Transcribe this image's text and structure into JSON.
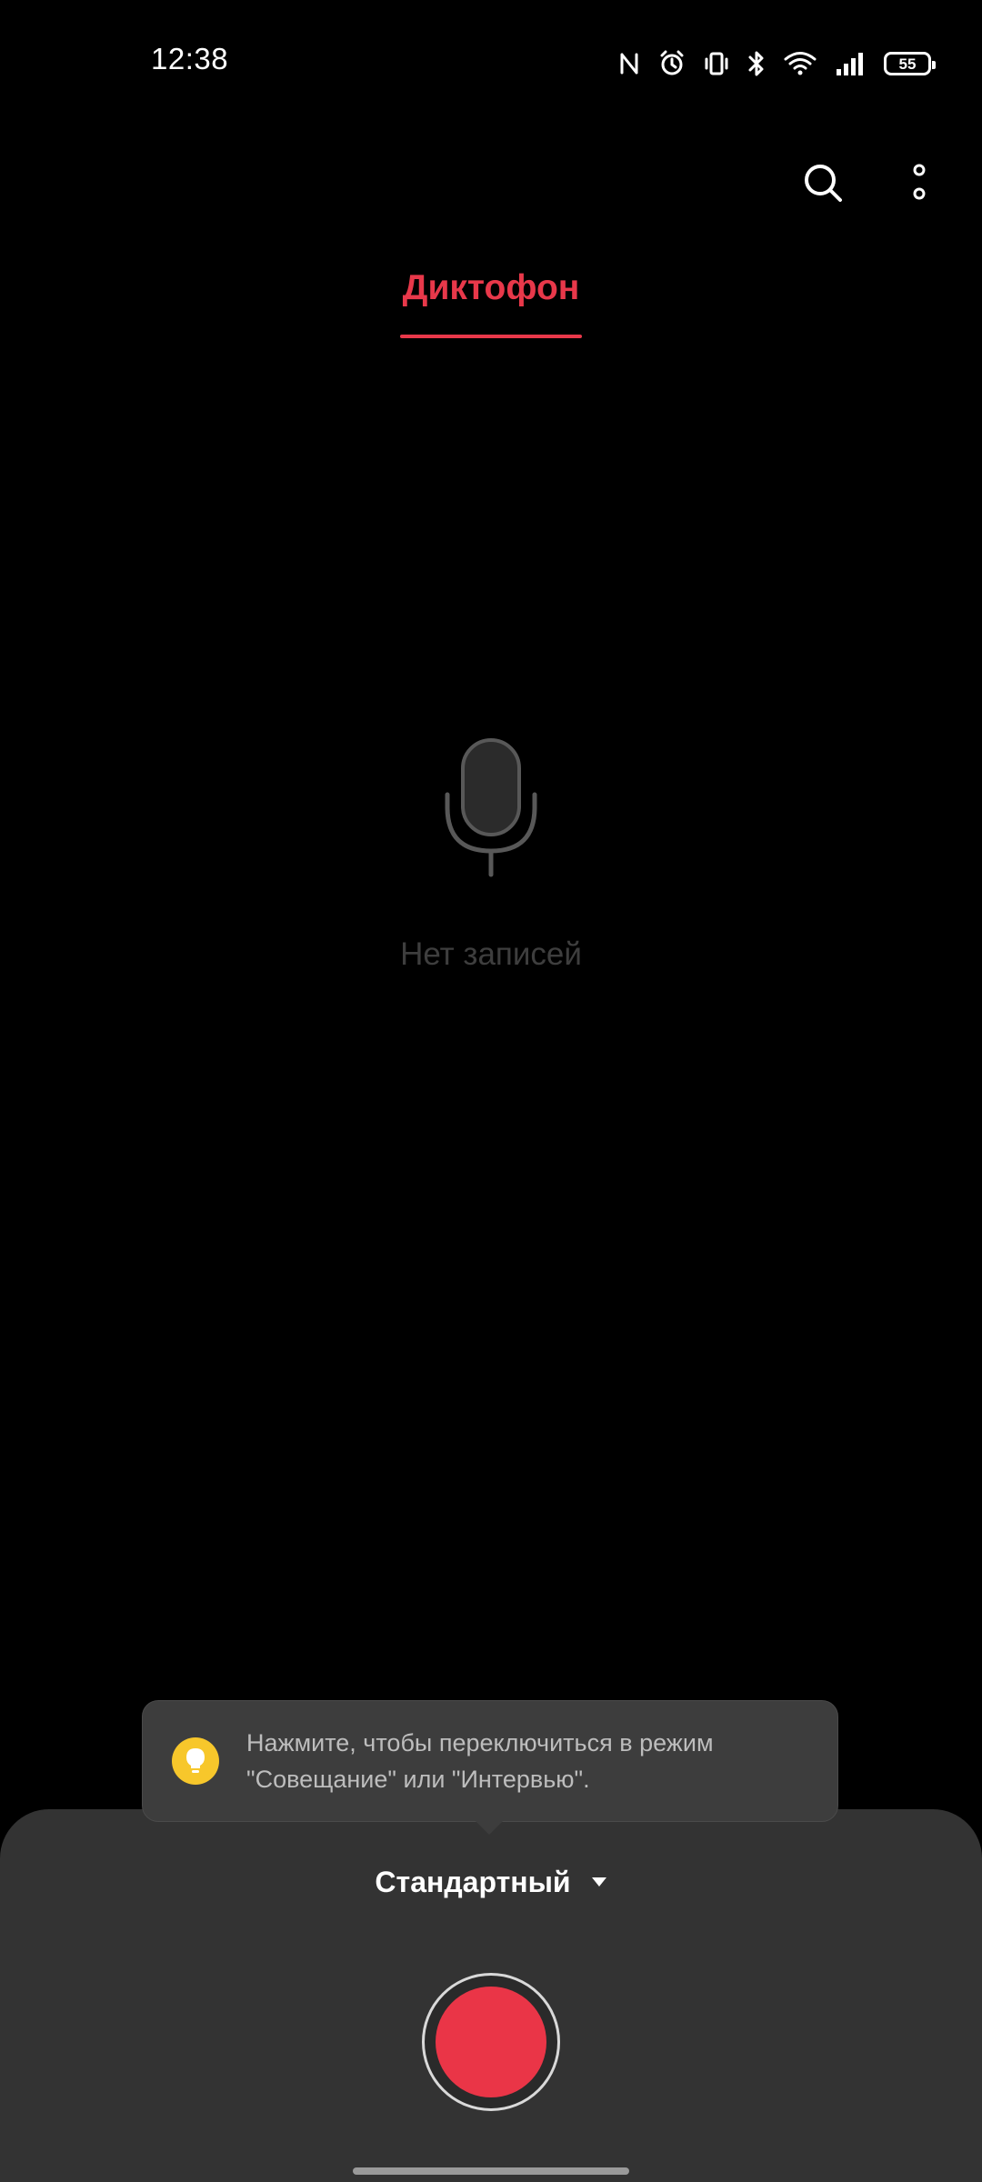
{
  "status_bar": {
    "time": "12:38",
    "battery_level": "55",
    "icons": [
      "nfc-icon",
      "alarm-icon",
      "vibrate-icon",
      "bluetooth-icon",
      "wifi-icon",
      "signal-icon",
      "battery-icon"
    ]
  },
  "toolbar": {
    "search_icon": "search-icon",
    "more_icon": "more-vertical-icon"
  },
  "tabs": [
    {
      "label": "Диктофон",
      "active": true
    }
  ],
  "empty_state": {
    "icon": "microphone-icon",
    "text": "Нет записей"
  },
  "tooltip": {
    "icon": "lightbulb-icon",
    "text": "Нажмите, чтобы переключиться в режим\n\"Совещание\" или \"Интервью\"."
  },
  "mode": {
    "selected": "Стандартный",
    "icon": "dropdown-triangle-icon"
  },
  "colors": {
    "accent": "#e8384a",
    "record": "#ea3547",
    "background": "#000000",
    "panel": "#333333",
    "tooltip": "#3d3d3d",
    "tip_icon": "#f7c72b"
  }
}
